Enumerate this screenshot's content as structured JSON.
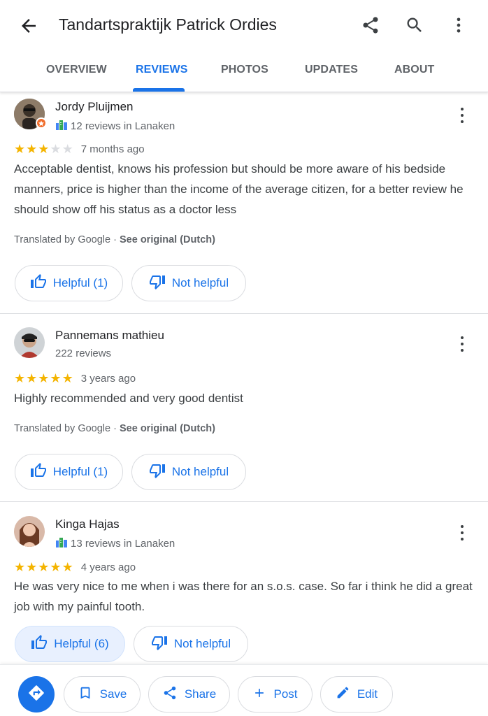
{
  "app_bar": {
    "title": "Tandartspraktijk Patrick Ordies",
    "icons": [
      "back-arrow-icon",
      "share-icon",
      "search-icon",
      "more-vert-icon"
    ]
  },
  "tabs": [
    {
      "label": "OVERVIEW",
      "active": false
    },
    {
      "label": "REVIEWS",
      "active": true
    },
    {
      "label": "PHOTOS",
      "active": false
    },
    {
      "label": "UPDATES",
      "active": false
    },
    {
      "label": "ABOUT",
      "active": false
    }
  ],
  "reviews": [
    {
      "author": "Jordy Pluijmen",
      "meta": "12 reviews in Lanaken",
      "local_guide": true,
      "rating": 3,
      "time": "7 months ago",
      "text": "Acceptable dentist, knows his profession but should be more aware of his bedside manners, price is higher than the income of the average citizen, for a better review he should show off his status as a doctor less",
      "translated_prefix": "Translated by Google · ",
      "see_original": "See original (Dutch)",
      "helpful_label": "Helpful (1)",
      "not_helpful_label": "Not helpful",
      "helpful_selected": false
    },
    {
      "author": "Pannemans mathieu",
      "meta": "222 reviews",
      "local_guide": false,
      "rating": 5,
      "time": "3 years ago",
      "text": "Highly recommended and very good dentist",
      "translated_prefix": "Translated by Google · ",
      "see_original": "See original (Dutch)",
      "helpful_label": "Helpful (1)",
      "not_helpful_label": "Not helpful",
      "helpful_selected": false
    },
    {
      "author": "Kinga Hajas",
      "meta": "13 reviews in Lanaken",
      "local_guide": true,
      "rating": 5,
      "time": "4 years ago",
      "text": "He was very nice to me when i was there for an s.o.s. case.  So far i think he did a great job with my painful tooth.",
      "helpful_label": "Helpful (6)",
      "not_helpful_label": "Not helpful",
      "helpful_selected": true
    }
  ],
  "bottom_actions": [
    {
      "icon": "directions-icon"
    },
    {
      "label": "Save",
      "icon": "bookmark-icon"
    },
    {
      "label": "Share",
      "icon": "share-icon"
    },
    {
      "label": "Post",
      "icon": "plus-icon"
    },
    {
      "label": "Edit",
      "icon": "pencil-icon"
    }
  ],
  "colors": {
    "accent": "#1a73e8",
    "star": "#f4b400",
    "star_empty": "#dadce0",
    "local_guide_badge": "#f06d2c",
    "selected_pill_bg": "#e8f0fe"
  }
}
